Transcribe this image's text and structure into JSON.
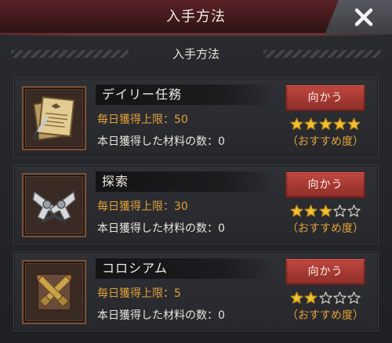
{
  "window": {
    "title": "入手方法",
    "close_icon": "close-icon"
  },
  "section": {
    "title": "入手方法"
  },
  "colors": {
    "accent_orange": "#e2a13a",
    "button_red": "#b0403a",
    "star_gold": "#f2c230"
  },
  "sources": [
    {
      "name": "デイリー任務",
      "icon": "mission-document-icon",
      "limit_text": "毎日獲得上限：50",
      "owned_text": "本日獲得した材料の数：0",
      "button_label": "向かう",
      "rating": 5,
      "rating_max": 5,
      "recommend_label": "（おすすめ度）"
    },
    {
      "name": "探索",
      "icon": "crossed-pistols-icon",
      "limit_text": "毎日獲得上限：30",
      "owned_text": "本日獲得した材料の数：0",
      "button_label": "向かう",
      "rating": 3,
      "rating_max": 5,
      "recommend_label": "（おすすめ度）"
    },
    {
      "name": "コロシアム",
      "icon": "crossed-bullets-icon",
      "limit_text": "毎日獲得上限：5",
      "owned_text": "本日獲得した材料の数：0",
      "button_label": "向かう",
      "rating": 2,
      "rating_max": 5,
      "recommend_label": "（おすすめ度）"
    }
  ]
}
